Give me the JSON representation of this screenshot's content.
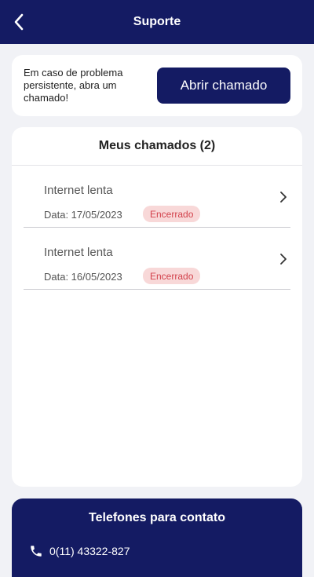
{
  "header": {
    "title": "Suporte"
  },
  "intro": {
    "message": "Em caso de problema persistente, abra um chamado!",
    "button_label": "Abrir chamado"
  },
  "tickets": {
    "title": "Meus chamados (2)",
    "items": [
      {
        "title": "Internet lenta",
        "date": "Data: 17/05/2023",
        "status": "Encerrado"
      },
      {
        "title": "Internet lenta",
        "date": "Data: 16/05/2023",
        "status": "Encerrado"
      }
    ]
  },
  "contact": {
    "title": "Telefones para contato",
    "phones": [
      "0(11) 43322-827"
    ]
  },
  "colors": {
    "brand": "#141b63",
    "status_bg": "#f8d8d8",
    "status_text": "#d2414b"
  },
  "icons": [
    "back-arrow-icon",
    "chevron-right-icon",
    "phone-icon"
  ]
}
